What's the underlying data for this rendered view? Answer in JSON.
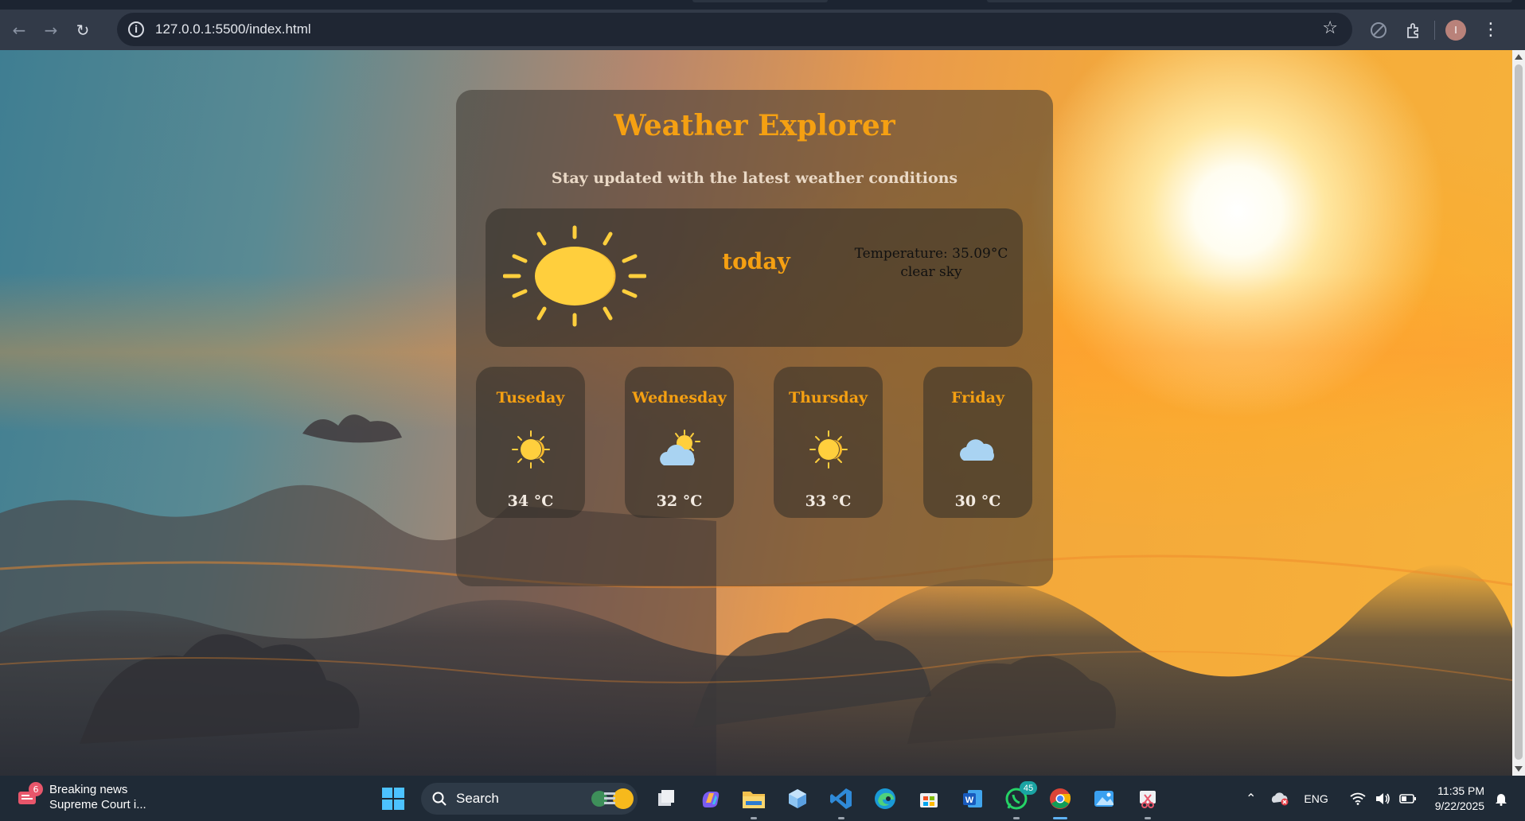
{
  "browser": {
    "url": "127.0.0.1:5500/index.html",
    "profile_initial": "I"
  },
  "app": {
    "title": "Weather Explorer",
    "subtitle": "Stay updated with the latest weather conditions",
    "today": {
      "label": "today",
      "temperature_text": "Temperature: 35.09°C",
      "description": "clear sky",
      "icon": "sun-icon"
    },
    "forecast": [
      {
        "day": "Tuseday",
        "temp": "34 °C",
        "icon": "sun-icon"
      },
      {
        "day": "Wednesday",
        "temp": "32 °C",
        "icon": "partly-cloudy-icon"
      },
      {
        "day": "Thursday",
        "temp": "33 °C",
        "icon": "sun-icon"
      },
      {
        "day": "Friday",
        "temp": "30 °C",
        "icon": "cloud-icon"
      }
    ],
    "colors": {
      "accent": "#f5a012",
      "sun": "#ffcf3d",
      "cloud": "#a9d3f2"
    }
  },
  "taskbar": {
    "news_badge": "6",
    "news_title": "Breaking news",
    "news_sub": "Supreme Court i...",
    "search_placeholder": "Search",
    "whatsapp_badge": "45",
    "language": "ENG",
    "time": "11:35 PM",
    "date": "9/22/2025"
  }
}
